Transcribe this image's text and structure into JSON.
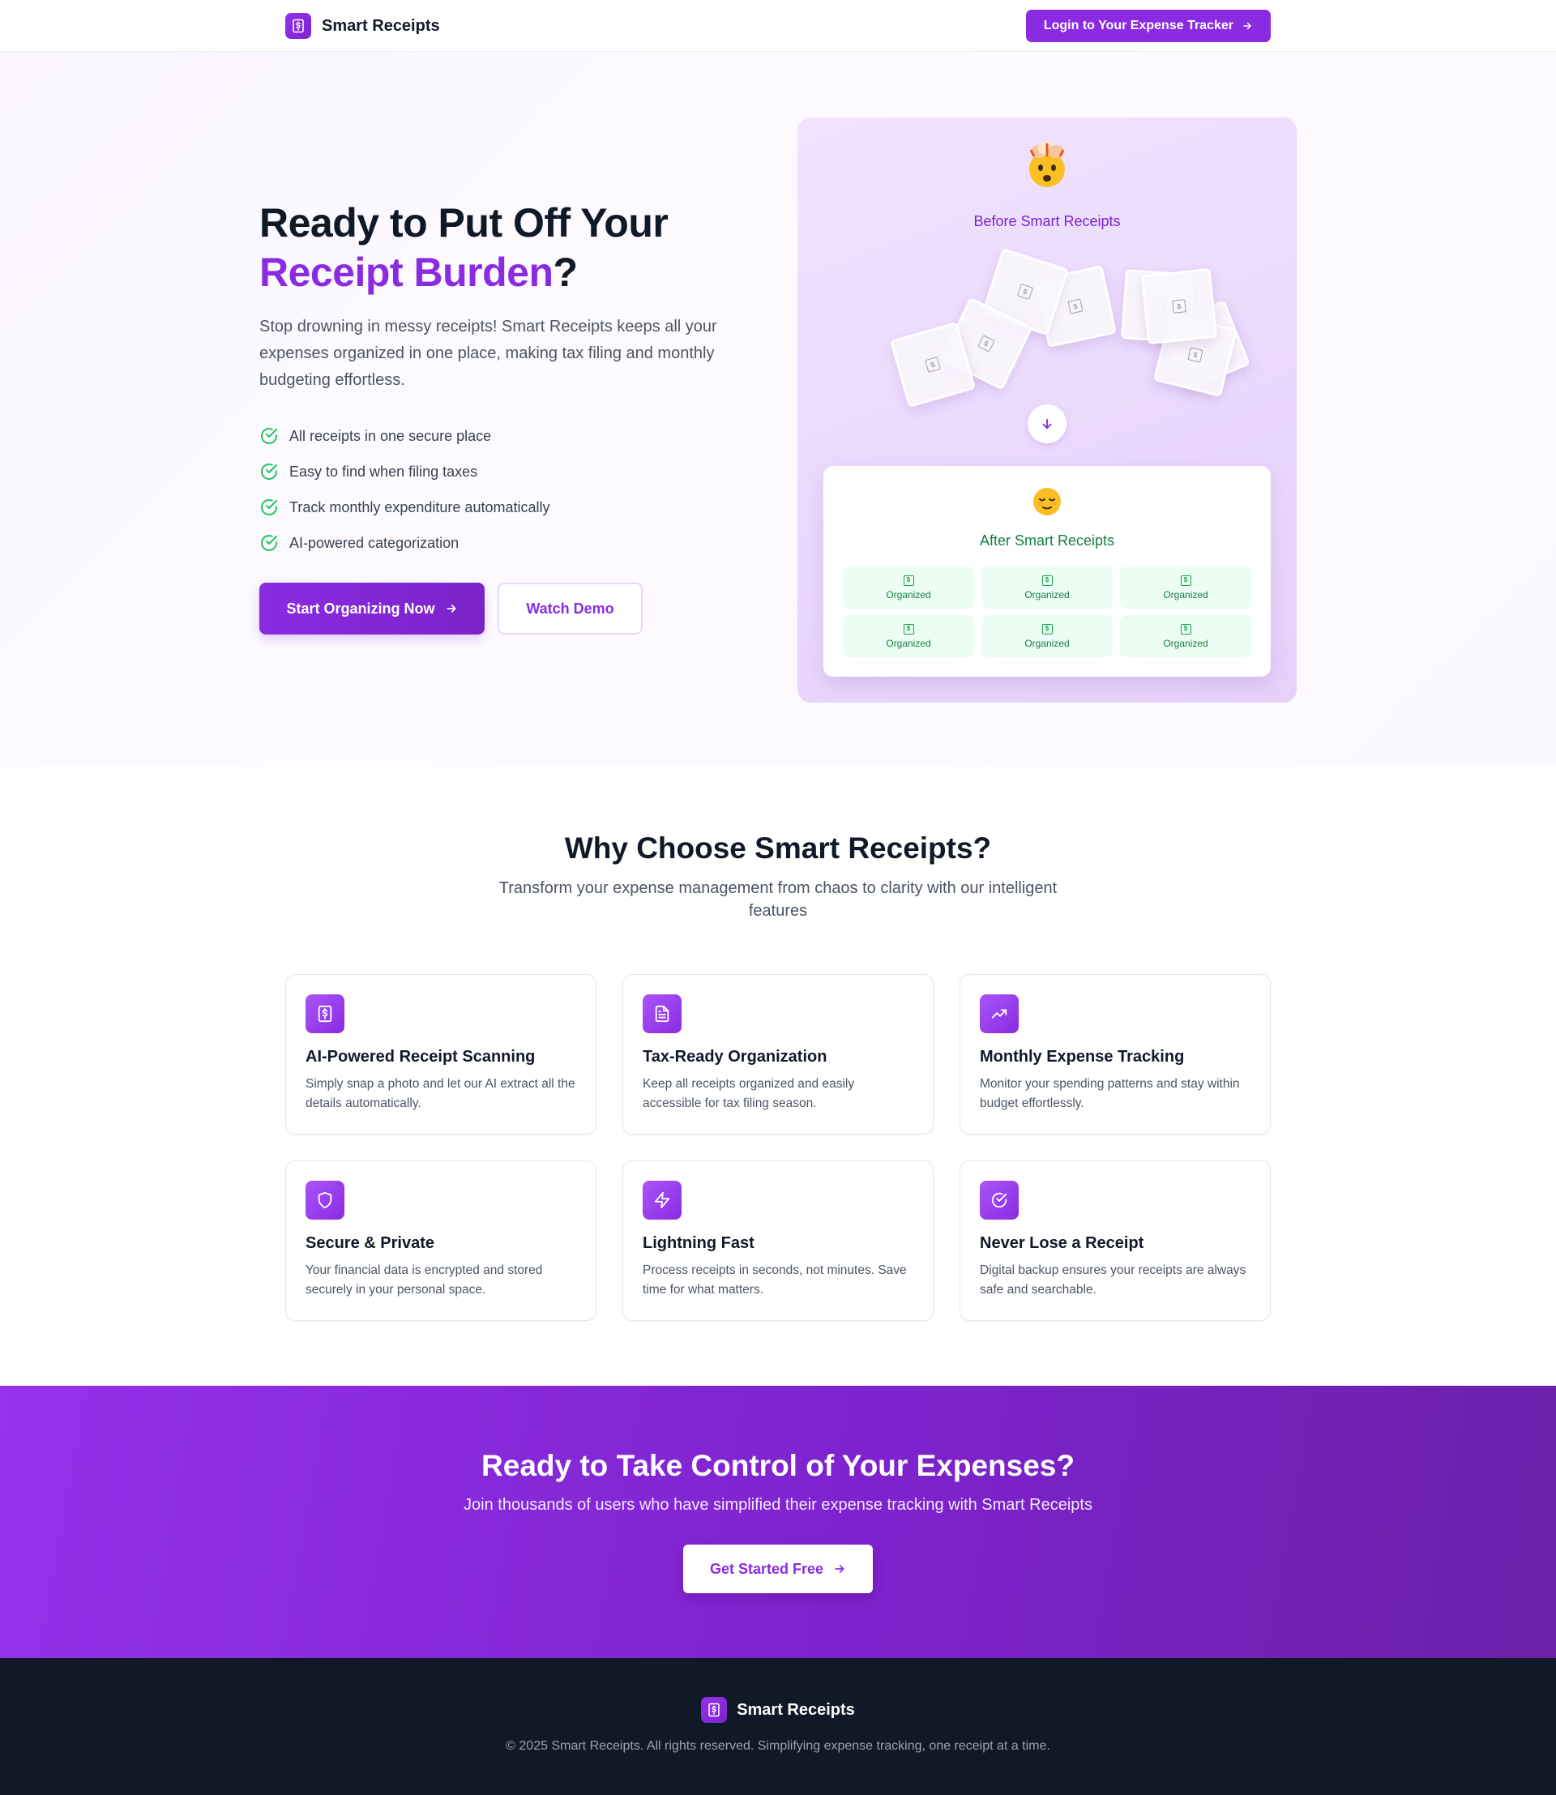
{
  "header": {
    "brand": "Smart Receipts",
    "login_label": "Login to Your Expense Tracker"
  },
  "hero": {
    "title_line1": "Ready to Put Off Your",
    "title_accent": "Receipt Burden",
    "title_end": "?",
    "description": "Stop drowning in messy receipts! Smart Receipts keeps all your expenses organized in one place, making tax filing and monthly budgeting effortless.",
    "benefits": [
      "All receipts in one secure place",
      "Easy to find when filing taxes",
      "Track monthly expenditure automatically",
      "AI-powered categorization"
    ],
    "primary_cta": "Start Organizing Now",
    "secondary_cta": "Watch Demo",
    "before_emoji": "🤯",
    "before_label": "Before Smart Receipts",
    "after_emoji": "😌",
    "after_label": "After Smart Receipts",
    "organized_items": [
      "Organized",
      "Organized",
      "Organized",
      "Organized",
      "Organized",
      "Organized"
    ]
  },
  "features": {
    "title": "Why Choose Smart Receipts?",
    "subtitle": "Transform your expense management from chaos to clarity with our intelligent features",
    "items": [
      {
        "icon": "receipt-icon",
        "title": "AI-Powered Receipt Scanning",
        "description": "Simply snap a photo and let our AI extract all the details automatically."
      },
      {
        "icon": "document-icon",
        "title": "Tax-Ready Organization",
        "description": "Keep all receipts organized and easily accessible for tax filing season."
      },
      {
        "icon": "trending-up-icon",
        "title": "Monthly Expense Tracking",
        "description": "Monitor your spending patterns and stay within budget effortlessly."
      },
      {
        "icon": "shield-icon",
        "title": "Secure & Private",
        "description": "Your financial data is encrypted and stored securely in your personal space."
      },
      {
        "icon": "lightning-icon",
        "title": "Lightning Fast",
        "description": "Process receipts in seconds, not minutes. Save time for what matters."
      },
      {
        "icon": "check-circle-icon",
        "title": "Never Lose a Receipt",
        "description": "Digital backup ensures your receipts are always safe and searchable."
      }
    ]
  },
  "cta": {
    "title": "Ready to Take Control of Your Expenses?",
    "subtitle": "Join thousands of users who have simplified their expense tracking with Smart Receipts",
    "button": "Get Started Free"
  },
  "footer": {
    "brand": "Smart Receipts",
    "copyright": "© 2025 Smart Receipts. All rights reserved. Simplifying expense tracking, one receipt at a time."
  },
  "colors": {
    "accent": "#8a2be2",
    "success": "#16a34a",
    "footer_bg": "#111827"
  }
}
